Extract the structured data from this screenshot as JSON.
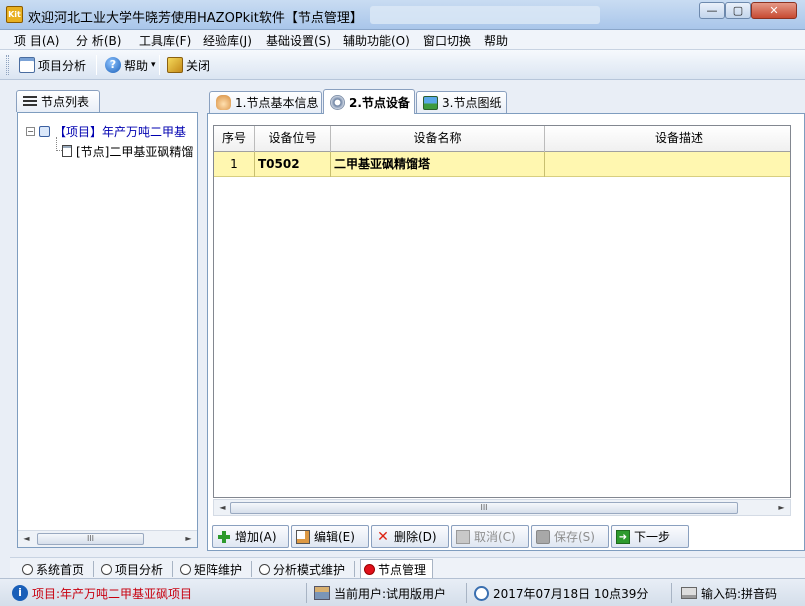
{
  "window": {
    "title": "欢迎河北工业大学牛晓芳使用HAZOPkit软件【节点管理】",
    "icon_label": "Kit",
    "min_glyph": "—",
    "max_glyph": "▢",
    "close_glyph": "✕"
  },
  "menu": [
    "项 目(A)",
    "分 析(B)",
    "工具库(F)",
    "经验库(J)",
    "基础设置(S)",
    "辅助功能(O)",
    "窗口切换",
    "帮助"
  ],
  "toolbar": {
    "project_analysis": "项目分析",
    "help": "帮助",
    "help_arrow": "▾",
    "close": "关闭"
  },
  "left_panel": {
    "tab_label": "节点列表",
    "tree": {
      "root_expander": "−",
      "root_label": "【项目】年产万吨二甲基",
      "child_label": "[节点]二甲基亚砜精馏"
    }
  },
  "tabs": [
    {
      "label": "1.节点基本信息",
      "active": false
    },
    {
      "label": "2.节点设备",
      "active": true
    },
    {
      "label": "3.节点图纸",
      "active": false
    }
  ],
  "table": {
    "columns": [
      "序号",
      "设备位号",
      "设备名称",
      "设备描述"
    ],
    "rows": [
      {
        "index": "1",
        "tag": "T0502",
        "name": "二甲基亚砜精馏塔",
        "desc": ""
      }
    ]
  },
  "scroll": {
    "left": "◄",
    "right": "►",
    "thumb": "III"
  },
  "actions": {
    "add": "增加(A)",
    "edit": "编辑(E)",
    "delete": "删除(D)",
    "cancel": "取消(C)",
    "save": "保存(S)",
    "next": "下一步"
  },
  "window_tabs": [
    "系统首页",
    "项目分析",
    "矩阵维护",
    "分析模式维护",
    "节点管理"
  ],
  "status": {
    "project": "项目:年产万吨二甲基亚砜项目",
    "user": "当前用户:试用版用户",
    "datetime": "2017年07月18日  10点39分",
    "input_method": "输入码:拼音码"
  },
  "colors": {
    "selected_row": "#fff7b0",
    "status_red": "#c8000f"
  }
}
